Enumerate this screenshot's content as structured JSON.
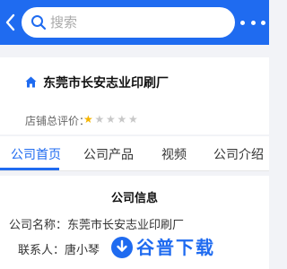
{
  "header": {
    "search_placeholder": "搜索"
  },
  "shop": {
    "name": "东莞市长安志业印刷厂",
    "rating_label": "店铺总评价：",
    "rating_stars": 1,
    "rating_max": 5
  },
  "tabs": [
    {
      "label": "公司首页",
      "active": true
    },
    {
      "label": "公司产品",
      "active": false
    },
    {
      "label": "视频",
      "active": false
    },
    {
      "label": "公司介绍",
      "active": false
    }
  ],
  "company_info": {
    "title": "公司信息",
    "rows": [
      "公司名称：东莞市长安志业印刷厂",
      "联系人：唐小琴"
    ]
  },
  "watermark": {
    "text": "谷普下载"
  },
  "colors": {
    "brand": "#1f6bf0",
    "star_on": "#f5b400",
    "star_off": "#c8c8c8"
  }
}
